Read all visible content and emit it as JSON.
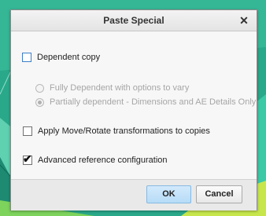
{
  "dialog": {
    "title": "Paste Special",
    "close_glyph": "✕"
  },
  "options": {
    "dependent_copy": {
      "label": "Dependent copy",
      "checked": false
    },
    "fully_dependent": {
      "label": "Fully Dependent with options to vary",
      "selected": false,
      "enabled": false
    },
    "partially_dependent": {
      "label": "Partially dependent - Dimensions and AE Details Only",
      "selected": true,
      "enabled": false
    },
    "apply_move_rotate": {
      "label": "Apply Move/Rotate transformations to copies",
      "checked": false
    },
    "advanced_reference": {
      "label": "Advanced reference configuration",
      "checked": true
    }
  },
  "buttons": {
    "ok": "OK",
    "cancel": "Cancel"
  },
  "icons": {
    "close": "close-icon",
    "check": "checkmark-icon"
  },
  "colors": {
    "background_teal": "#2aa88a",
    "ok_button": "#c4e2f9"
  }
}
